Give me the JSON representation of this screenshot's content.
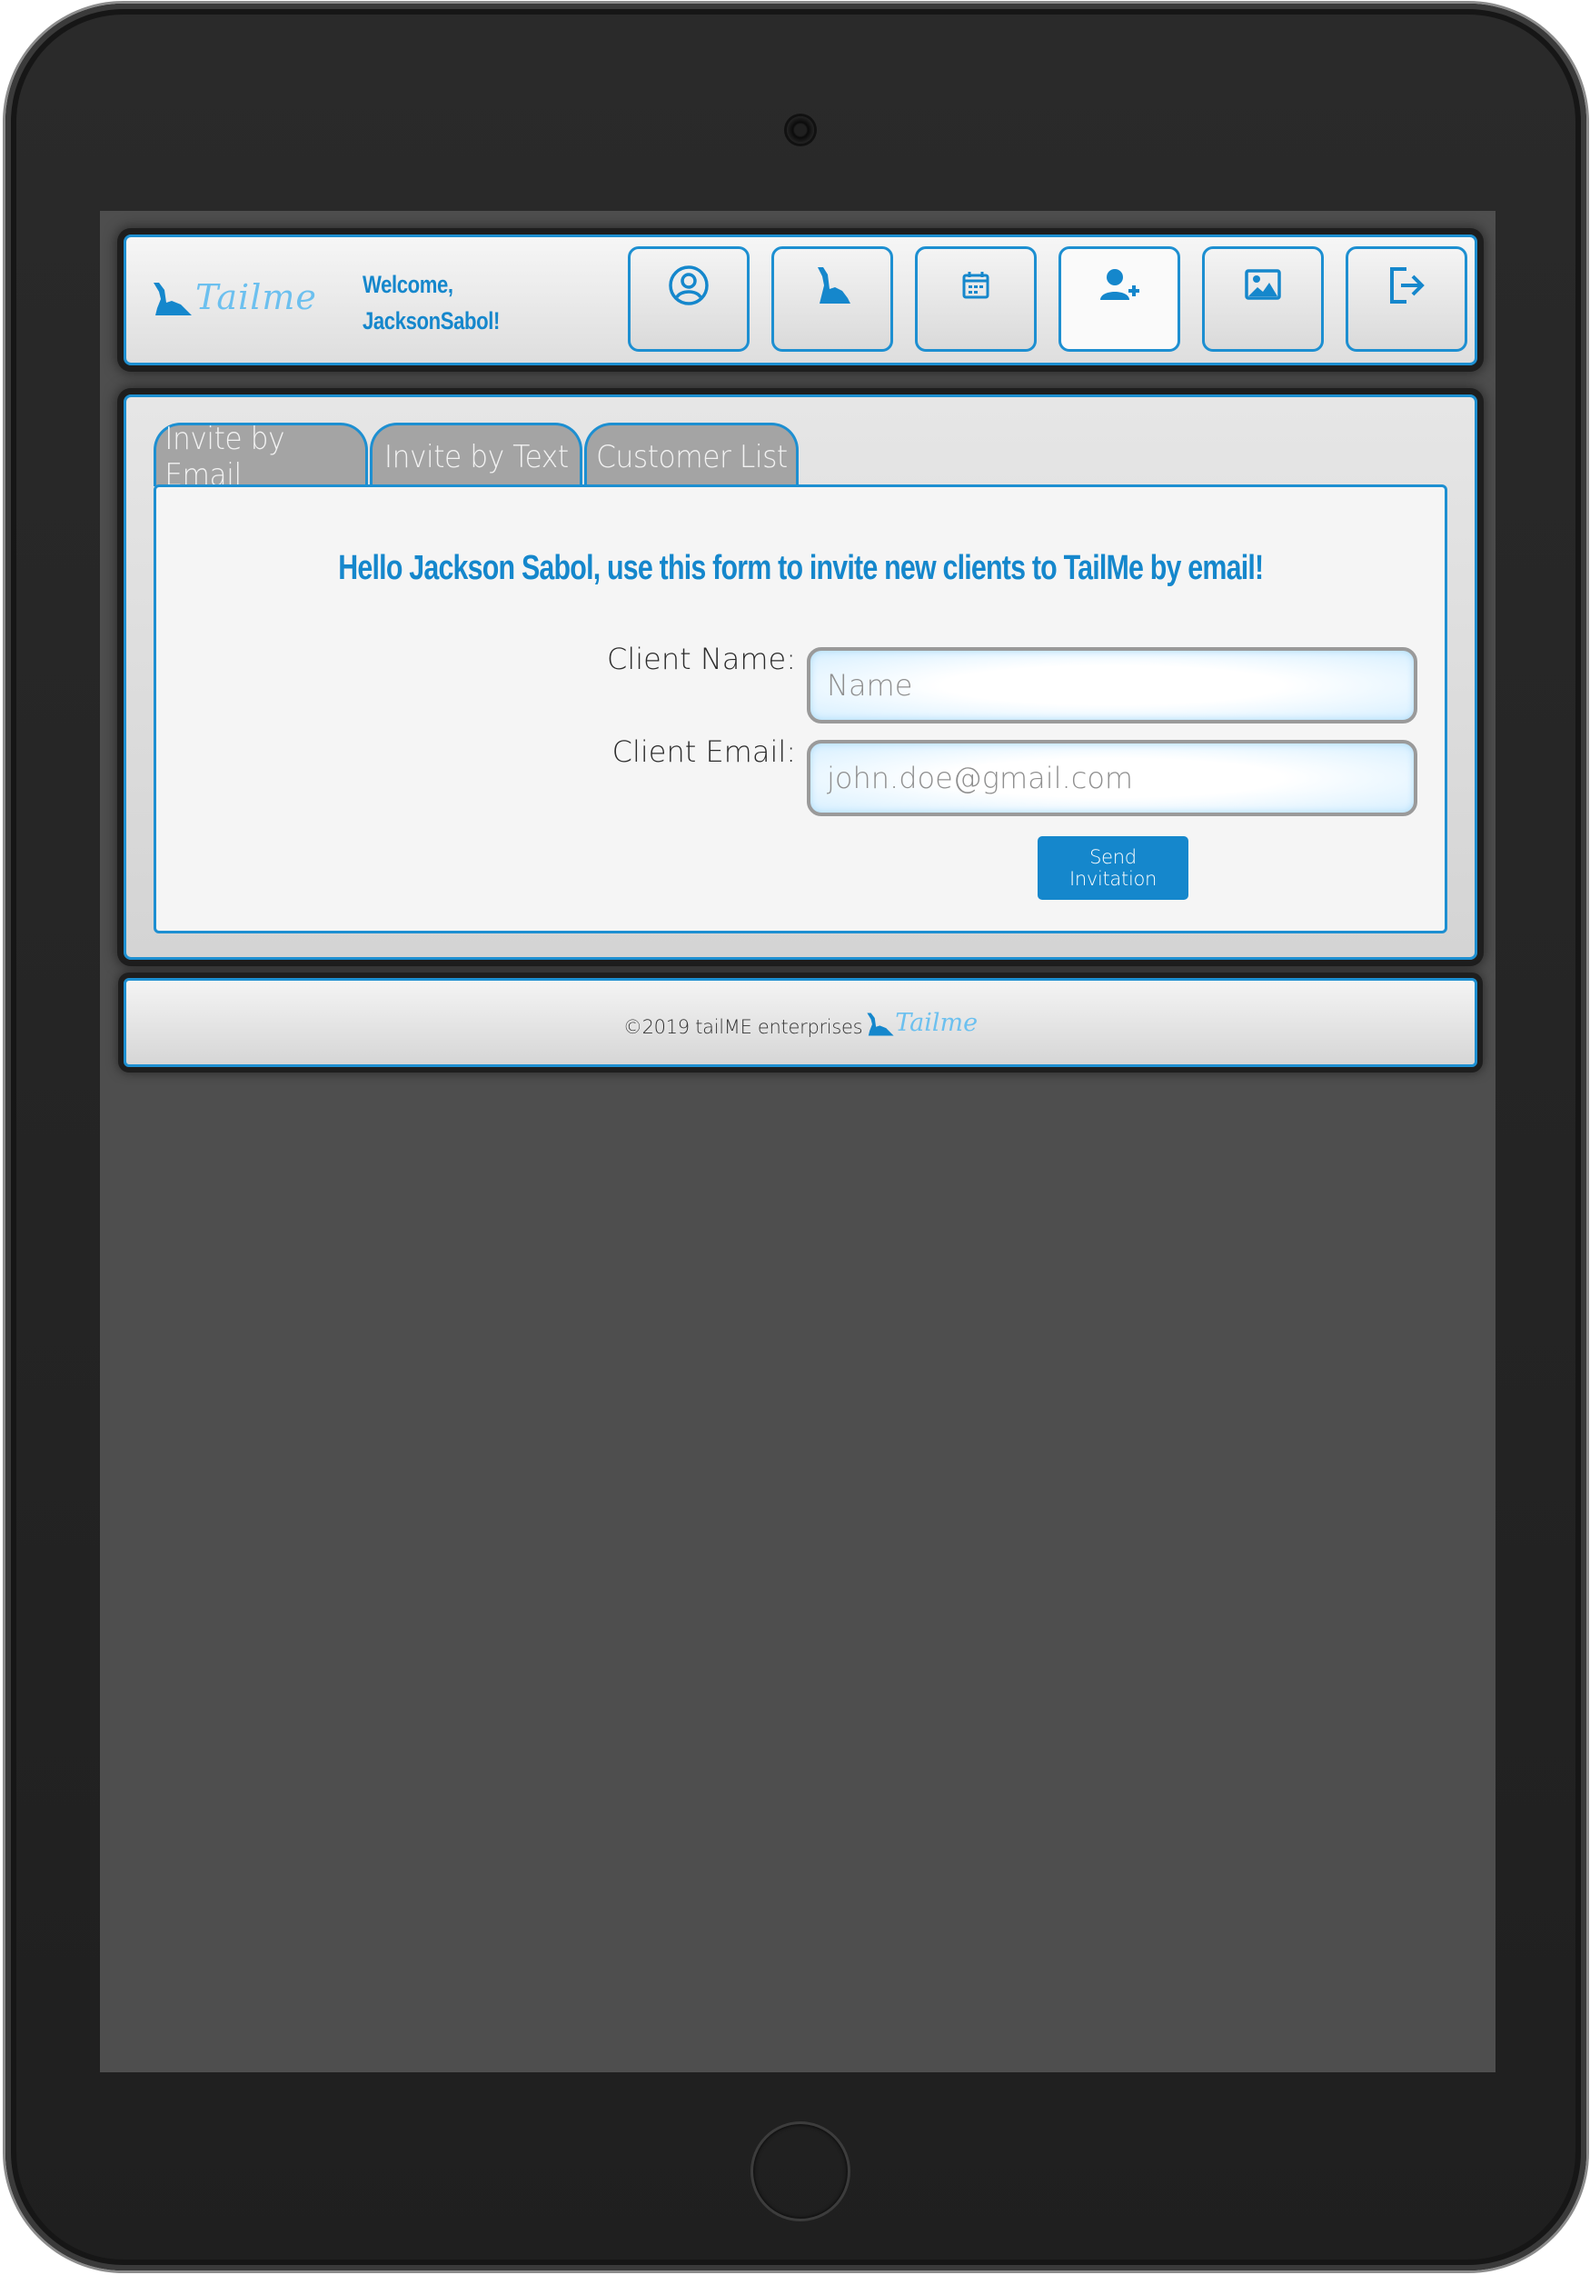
{
  "app": {
    "brand": "Tailme",
    "welcome_line1": "Welcome,",
    "welcome_line2": "JacksonSabol!"
  },
  "nav": {
    "items": [
      {
        "icon": "profile-icon",
        "active": false
      },
      {
        "icon": "dog-icon",
        "active": false
      },
      {
        "icon": "calendar-icon",
        "active": false
      },
      {
        "icon": "add-user-icon",
        "active": true
      },
      {
        "icon": "image-icon",
        "active": false
      },
      {
        "icon": "logout-icon",
        "active": false
      }
    ]
  },
  "tabs": [
    {
      "label": "Invite by Email",
      "active": true
    },
    {
      "label": "Invite by Text",
      "active": false
    },
    {
      "label": "Customer List",
      "active": false
    }
  ],
  "form": {
    "headline": "Hello Jackson Sabol, use this form to invite new clients to TailMe by email!",
    "name_label": "Client Name:",
    "name_placeholder": "Name",
    "email_label": "Client Email:",
    "email_placeholder": "john.doe@gmail.com",
    "submit_label": "Send Invitation"
  },
  "footer": {
    "copyright": "©2019 tailME enterprises",
    "brand": "Tailme"
  },
  "colors": {
    "accent": "#1d8fd1",
    "text_accent": "#1587cc",
    "brand_light": "#6cc0ef",
    "tab_inactive": "#a4a4a4",
    "screen_bg": "#4e4e4e"
  }
}
